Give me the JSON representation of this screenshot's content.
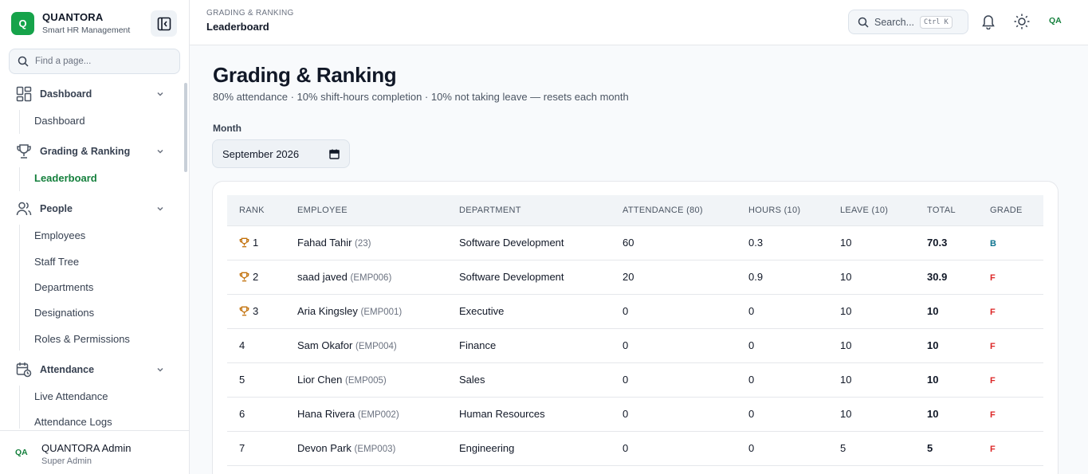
{
  "brand": {
    "logo": "Q",
    "name": "QUANTORA",
    "subtitle": "Smart HR Management"
  },
  "sidebar": {
    "find_placeholder": "Find a page...",
    "groups": [
      {
        "label": "Dashboard",
        "icon": "dashboard-icon",
        "items": [
          "Dashboard"
        ]
      },
      {
        "label": "Grading & Ranking",
        "icon": "trophy-icon",
        "items": [
          "Leaderboard"
        ],
        "active_item": "Leaderboard"
      },
      {
        "label": "People",
        "icon": "people-icon",
        "items": [
          "Employees",
          "Staff Tree",
          "Departments",
          "Designations",
          "Roles & Permissions"
        ]
      },
      {
        "label": "Attendance",
        "icon": "calendar-clock-icon",
        "items": [
          "Live Attendance",
          "Attendance Logs"
        ]
      }
    ],
    "user": {
      "initials": "QA",
      "name": "QUANTORA Admin",
      "role": "Super Admin"
    }
  },
  "header": {
    "breadcrumb": "GRADING & RANKING",
    "title": "Leaderboard",
    "search_placeholder": "Search...",
    "search_shortcut": "Ctrl K",
    "avatar_initials": "QA"
  },
  "page": {
    "title": "Grading & Ranking",
    "subtitle": "80% attendance · 10% shift-hours completion · 10% not taking leave — resets each month",
    "month_label": "Month",
    "month_value": "September 2026"
  },
  "table": {
    "columns": [
      "RANK",
      "EMPLOYEE",
      "DEPARTMENT",
      "ATTENDANCE (80)",
      "HOURS (10)",
      "LEAVE (10)",
      "TOTAL",
      "GRADE"
    ],
    "rows": [
      {
        "rank": "1",
        "trophy": true,
        "name": "Fahad Tahir",
        "code": "(23)",
        "department": "Software Development",
        "attendance": "60",
        "hours": "0.3",
        "leave": "10",
        "total": "70.3",
        "grade": "B"
      },
      {
        "rank": "2",
        "trophy": true,
        "name": "saad javed",
        "code": "(EMP006)",
        "department": "Software Development",
        "attendance": "20",
        "hours": "0.9",
        "leave": "10",
        "total": "30.9",
        "grade": "F"
      },
      {
        "rank": "3",
        "trophy": true,
        "name": "Aria Kingsley",
        "code": "(EMP001)",
        "department": "Executive",
        "attendance": "0",
        "hours": "0",
        "leave": "10",
        "total": "10",
        "grade": "F"
      },
      {
        "rank": "4",
        "trophy": false,
        "name": "Sam Okafor",
        "code": "(EMP004)",
        "department": "Finance",
        "attendance": "0",
        "hours": "0",
        "leave": "10",
        "total": "10",
        "grade": "F"
      },
      {
        "rank": "5",
        "trophy": false,
        "name": "Lior Chen",
        "code": "(EMP005)",
        "department": "Sales",
        "attendance": "0",
        "hours": "0",
        "leave": "10",
        "total": "10",
        "grade": "F"
      },
      {
        "rank": "6",
        "trophy": false,
        "name": "Hana Rivera",
        "code": "(EMP002)",
        "department": "Human Resources",
        "attendance": "0",
        "hours": "0",
        "leave": "10",
        "total": "10",
        "grade": "F"
      },
      {
        "rank": "7",
        "trophy": false,
        "name": "Devon Park",
        "code": "(EMP003)",
        "department": "Engineering",
        "attendance": "0",
        "hours": "0",
        "leave": "5",
        "total": "5",
        "grade": "F"
      }
    ]
  },
  "colors": {
    "accent": "#16a34a",
    "grade_b": "#0e7490",
    "grade_f": "#dc2626",
    "trophy": "#c2700a"
  }
}
